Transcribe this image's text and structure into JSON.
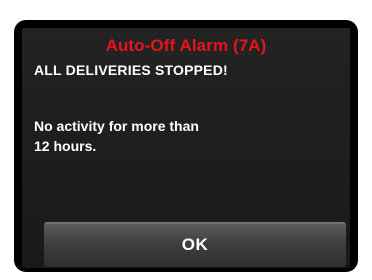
{
  "alarm": {
    "title": "Auto-Off Alarm (7A)",
    "headline": "ALL DELIVERIES STOPPED!",
    "message": "No activity for more than\n12 hours."
  },
  "actions": {
    "ok_label": "OK"
  },
  "colors": {
    "title": "#e8141b",
    "text": "#ffffff",
    "panel_background": "#1e1e1e",
    "screen_border": "#000000",
    "button_background": "#404040"
  }
}
